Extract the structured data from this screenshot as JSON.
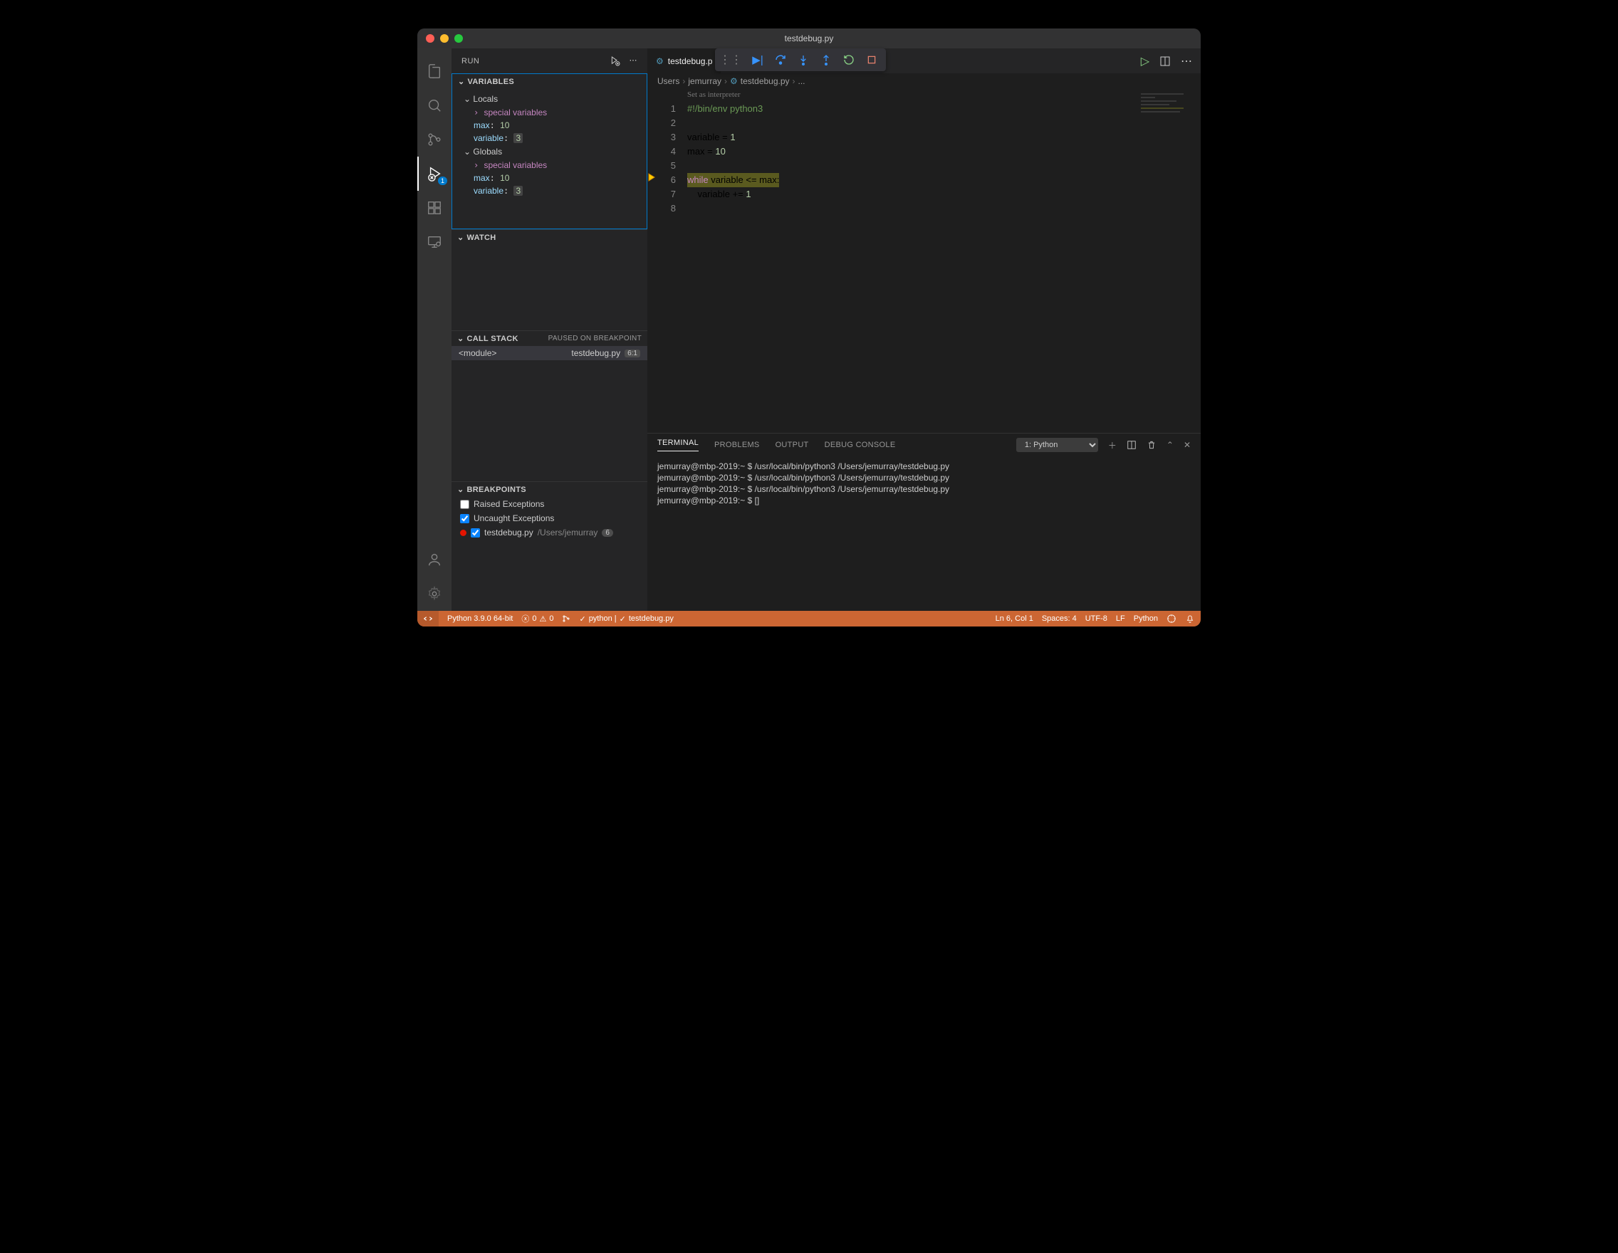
{
  "title": "testdebug.py",
  "sidebar_title": "RUN",
  "sections": {
    "variables": "Variables",
    "watch": "Watch",
    "callstack": "Call Stack",
    "callstack_status": "PAUSED ON BREAKPOINT",
    "breakpoints": "Breakpoints"
  },
  "variables": {
    "locals_label": "Locals",
    "globals_label": "Globals",
    "special": "special variables",
    "items": [
      {
        "name": "max",
        "value": "10"
      },
      {
        "name": "variable",
        "value": "3",
        "hl": true
      }
    ]
  },
  "callstack": {
    "frame": "<module>",
    "file": "testdebug.py",
    "loc": "6:1"
  },
  "breakpoints": {
    "raised": "Raised Exceptions",
    "uncaught": "Uncaught Exceptions",
    "file": "testdebug.py",
    "path": "/Users/jemurray",
    "count": "6"
  },
  "tab": {
    "file": "testdebug.p"
  },
  "breadcrumb": [
    "Users",
    "jemurray",
    "testdebug.py",
    "..."
  ],
  "hint": "Set as interpreter",
  "code": {
    "lines": [
      "1",
      "2",
      "3",
      "4",
      "5",
      "6",
      "7",
      "8"
    ],
    "l1": "#!/bin/env python3",
    "l3_a": "variable",
    "l3_b": " = ",
    "l3_c": "1",
    "l4_a": "max",
    "l4_b": " = ",
    "l4_c": "10",
    "l6_a": "while",
    "l6_b": " variable <= max:",
    "l7": "    variable += ",
    "l7_c": "1"
  },
  "panel": {
    "tabs": [
      "TERMINAL",
      "PROBLEMS",
      "OUTPUT",
      "DEBUG CONSOLE"
    ],
    "dropdown": "1: Python",
    "lines": [
      "jemurray@mbp-2019:~ $ /usr/local/bin/python3 /Users/jemurray/testdebug.py",
      "jemurray@mbp-2019:~ $ /usr/local/bin/python3 /Users/jemurray/testdebug.py",
      "jemurray@mbp-2019:~ $ /usr/local/bin/python3 /Users/jemurray/testdebug.py",
      "jemurray@mbp-2019:~ $ []"
    ]
  },
  "status": {
    "interpreter": "Python 3.9.0 64-bit",
    "errors": "0",
    "warnings": "0",
    "checks": "python |",
    "checks2": "testdebug.py",
    "pos": "Ln 6, Col 1",
    "spaces": "Spaces: 4",
    "encoding": "UTF-8",
    "eol": "LF",
    "lang": "Python"
  }
}
